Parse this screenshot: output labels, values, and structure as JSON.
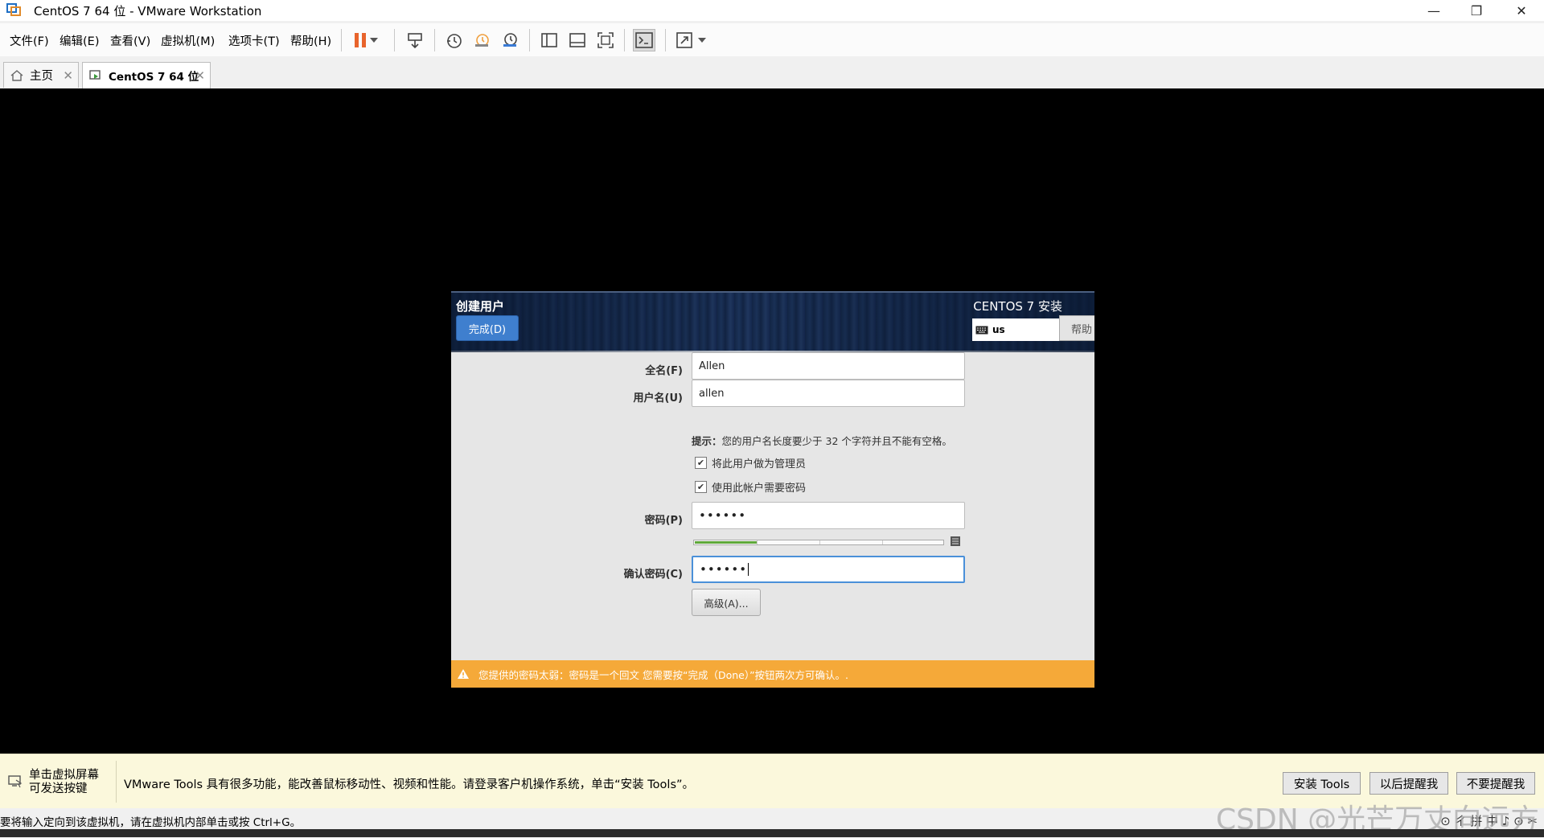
{
  "window": {
    "title": "CentOS 7 64 位 - VMware Workstation",
    "minimize": "—",
    "restore": "❐",
    "close": "✕"
  },
  "menu": [
    "文件(F)",
    "编辑(E)",
    "查看(V)",
    "虚拟机(M)",
    "选项卡(T)",
    "帮助(H)"
  ],
  "tabs": [
    {
      "label": "主页",
      "icon": "home-icon"
    },
    {
      "label": "CentOS 7 64 位",
      "icon": "vm-icon"
    }
  ],
  "installer": {
    "title": "创建用户",
    "done_button": "完成(D)",
    "product": "CENTOS 7 安装",
    "keyboard_layout": "us",
    "help_button": "帮助",
    "fullname_label": "全名(F)",
    "fullname_value": "Allen",
    "username_label": "用户名(U)",
    "username_value": "allen",
    "hint_bold": "提示：",
    "hint_text": "您的用户名长度要少于 32 个字符并且不能有空格。",
    "admin_checkbox": "将此用户做为管理员",
    "admin_checked": true,
    "require_password_checkbox": "使用此帐户需要密码",
    "require_password_checked": true,
    "password_label": "密码(P)",
    "password_value": "••••••",
    "password_strength": 0.25,
    "confirm_label": "确认密码(C)",
    "confirm_value": "••••••",
    "advanced_button": "高级(A)...",
    "warning": "您提供的密码太弱：密码是一个回文 您需要按“完成（Done）”按钮两次方可确认。."
  },
  "tools_bar": {
    "click_text_1": "单击虚拟屏幕",
    "click_text_2": "可发送按键",
    "message": "VMware Tools 具有很多功能，能改善鼠标移动性、视频和性能。请登录客户机操作系统，单击“安装 Tools”。",
    "install_button": "安装 Tools",
    "later_button": "以后提醒我",
    "never_button": "不要提醒我"
  },
  "status_bar": {
    "text": "要将输入定向到该虚拟机，请在虚拟机内部单击或按 Ctrl+G。",
    "tray": "⊙ ㄔ 拼 中 ♪ ⊙ ✂"
  },
  "watermark": "CSDN @光芒万丈向远方",
  "colors": {
    "accent_blue": "#3f7fce",
    "warning_orange": "#f5a939",
    "strength_green": "#5fa83a",
    "pause_orange": "#e8642c"
  }
}
